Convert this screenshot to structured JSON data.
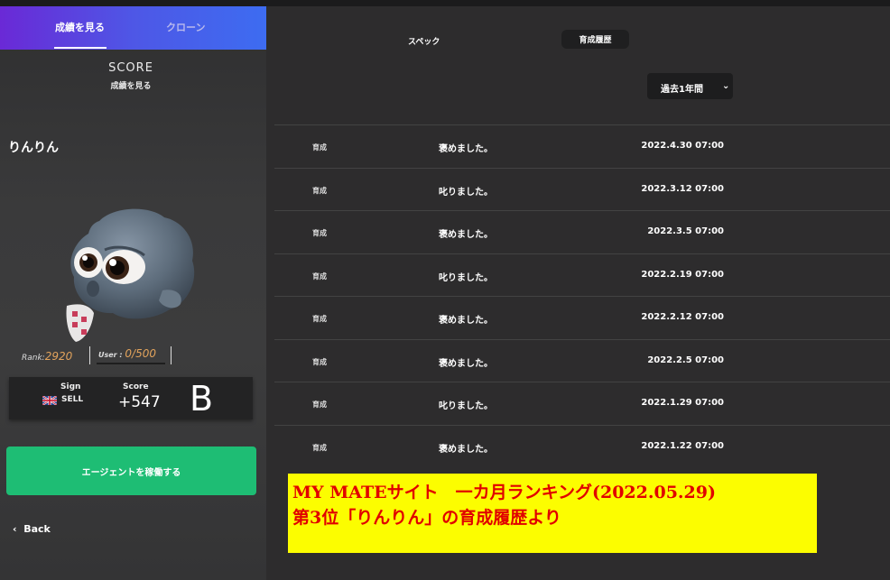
{
  "tabs": {
    "active": "成績を見る",
    "inactive": "クローン"
  },
  "score_header": {
    "title": "SCORE",
    "subtitle": "成績を見る"
  },
  "mate_name": "りんりん",
  "stats": {
    "rank_label": "Rank:",
    "rank_value": "2920",
    "user_label": "User : ",
    "user_value": "0/500"
  },
  "scorebox": {
    "sign_label": "Sign",
    "sign_value": "SELL",
    "score_label": "Score",
    "score_value": "+547",
    "grade": "B"
  },
  "agent_button": "エージェントを稼働する",
  "back": {
    "icon": "chevron-left-icon",
    "label": "Back"
  },
  "right_tabs": {
    "spec": "スペック",
    "history": "育成履歴"
  },
  "period_select": {
    "value": "過去1年間",
    "icon": "chevron-down-icon"
  },
  "history": [
    {
      "type": "育成",
      "action": "褒めました。",
      "date": "2022.4.30 07:00"
    },
    {
      "type": "育成",
      "action": "叱りました。",
      "date": "2022.3.12 07:00"
    },
    {
      "type": "育成",
      "action": "褒めました。",
      "date": "2022.3.5 07:00"
    },
    {
      "type": "育成",
      "action": "叱りました。",
      "date": "2022.2.19 07:00"
    },
    {
      "type": "育成",
      "action": "褒めました。",
      "date": "2022.2.12 07:00"
    },
    {
      "type": "育成",
      "action": "褒めました。",
      "date": "2022.2.5 07:00"
    },
    {
      "type": "育成",
      "action": "叱りました。",
      "date": "2022.1.29 07:00"
    },
    {
      "type": "育成",
      "action": "褒めました。",
      "date": "2022.1.22 07:00"
    }
  ],
  "caption": {
    "line1": "MY MATEサイト　一カ月ランキング(2022.05.29)",
    "line2": "第3位「りんりん」の育成履歴より"
  },
  "colors": {
    "tab_gradient_start": "#6a29d6",
    "tab_gradient_end": "#3d6cf1",
    "agent_button": "#1ebd74",
    "accent_value": "#e2a35c",
    "caption_bg": "#fcfd00",
    "caption_text": "#e10000"
  }
}
